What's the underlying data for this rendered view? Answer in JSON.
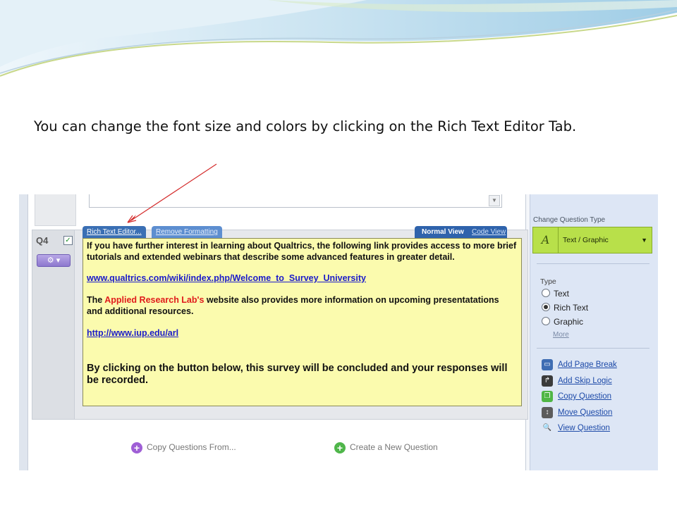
{
  "caption": "You can change the font size and colors by clicking on the Rich Text Editor Tab.",
  "colors": {
    "editor_bg": "#fbfbae",
    "arrow": "#d42b2b",
    "tab_blue": "#3a6fb4",
    "type_green": "#b8e04a"
  },
  "question": {
    "number": "Q4",
    "checkbox_icon": "check-icon",
    "gear_icon": "gear-icon",
    "tabs": {
      "rich_text_editor": "Rich Text Editor...",
      "remove_formatting": "Remove Formatting",
      "normal_view": "Normal View",
      "code_view": "Code View"
    },
    "editor": {
      "p1": "If you have further interest in learning about Qualtrics, the following link provides access to more brief tutorials and extended webinars that describe some advanced features in greater detail.",
      "link1": "www.qualtrics.com/wiki/index.php/Welcome_to_Survey_University",
      "p2_pre": "The ",
      "p2_red": "Applied Research Lab's",
      "p2_post": " website also provides more information on upcoming presentatations and additional resources.",
      "link2": "http://www.iup.edu/arl",
      "p3": "By clicking on the button below, this survey will be concluded and your responses will be recorded."
    }
  },
  "bottom": {
    "copy_questions": "Copy Questions From...",
    "create_question": "Create a New Question"
  },
  "right_panel": {
    "change_type_heading": "Change Question Type",
    "current_type": "Text / Graphic",
    "type_title": "Type",
    "radios": [
      {
        "label": "Text",
        "selected": false
      },
      {
        "label": "Rich Text",
        "selected": true
      },
      {
        "label": "Graphic",
        "selected": false
      }
    ],
    "more": "More",
    "tools": {
      "page_break": "Add Page Break",
      "skip_logic": "Add Skip Logic",
      "copy_question": "Copy Question",
      "move_question": "Move Question",
      "view_question": "View Question"
    }
  }
}
